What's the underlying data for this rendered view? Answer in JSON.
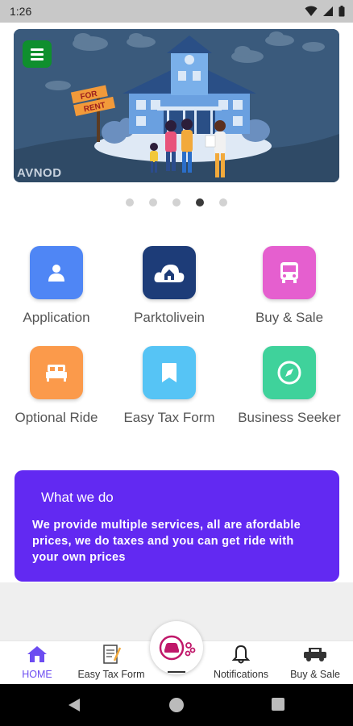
{
  "status_bar": {
    "time": "1:26"
  },
  "banner": {
    "sign_text_line1": "FOR",
    "sign_text_line2": "RENT",
    "watermark": "AVNOD",
    "carousel_count": 5,
    "carousel_active_index": 3
  },
  "services": [
    {
      "label": "Application",
      "icon": "user-icon",
      "color": "#4f86f5"
    },
    {
      "label": "Parktolivein",
      "icon": "home-cloud-icon",
      "color": "#1d3c78"
    },
    {
      "label": "Buy & Sale",
      "icon": "bus-icon",
      "color": "#e55fcf"
    },
    {
      "label": "Optional Ride",
      "icon": "bed-icon",
      "color": "#fb9a4b"
    },
    {
      "label": "Easy Tax Form",
      "icon": "bookmark-icon",
      "color": "#56c4f5"
    },
    {
      "label": "Business Seeker",
      "icon": "compass-icon",
      "color": "#3fd29b"
    }
  ],
  "what_we_do": {
    "title": "What we do",
    "text": "We provide multiple services, all are afordable prices, we do taxes and you can get ride with your own prices"
  },
  "bottom_nav": {
    "items": [
      {
        "label": "HOME",
        "icon": "home-icon",
        "active": true
      },
      {
        "label": "Easy Tax Form",
        "icon": "tax-form-icon",
        "active": false
      },
      {
        "label": "Notifications",
        "icon": "bell-icon",
        "active": false
      },
      {
        "label": "Buy & Sale",
        "icon": "car-sale-icon",
        "active": false
      }
    ],
    "center_icon": "car-share-icon"
  },
  "colors": {
    "accent": "#6c4cf1",
    "card": "#6229f2",
    "menu_button": "#0f8f2e"
  }
}
